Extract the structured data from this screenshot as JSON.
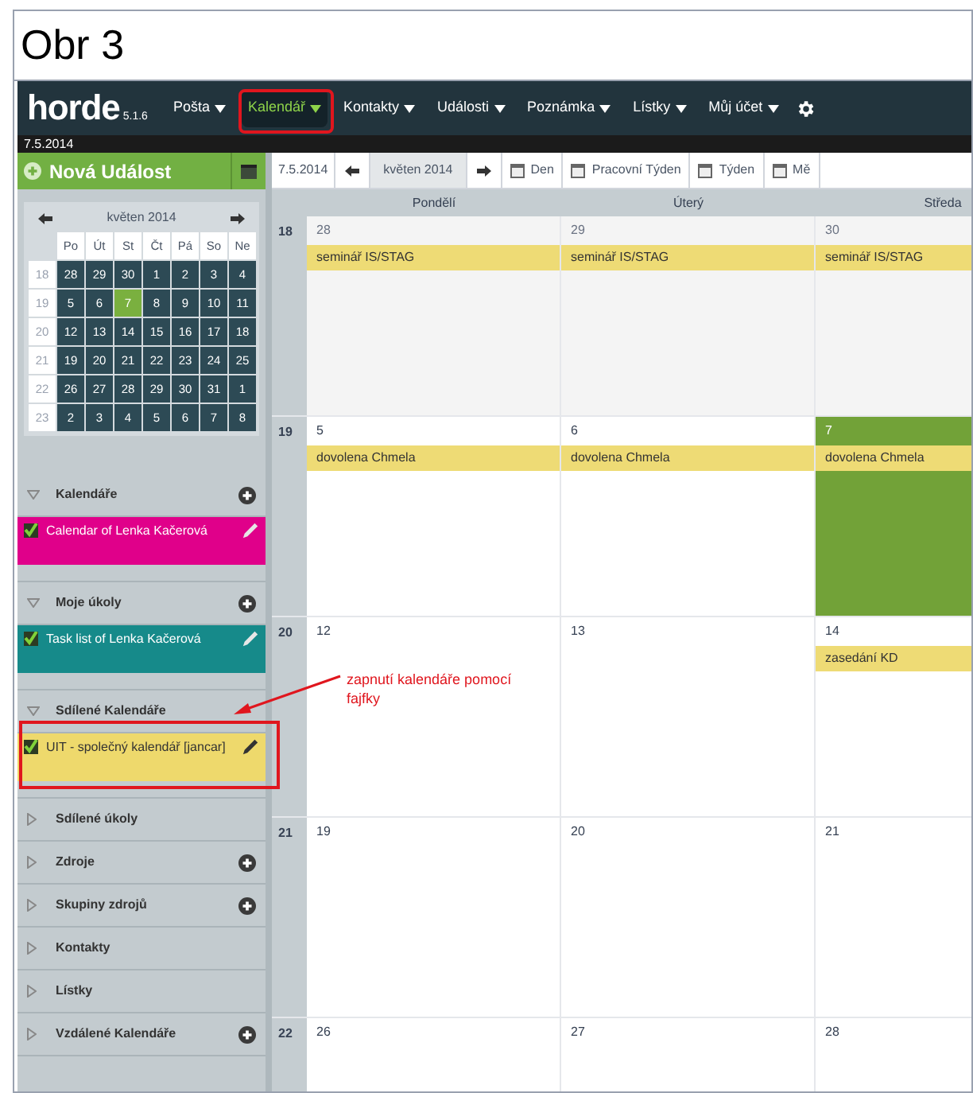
{
  "caption": "Obr 3",
  "app": {
    "logo": "horde",
    "version": "5.1.6",
    "menu": [
      {
        "label": "Pošta",
        "selected": false
      },
      {
        "label": "Kalendář",
        "selected": true
      },
      {
        "label": "Kontakty",
        "selected": false
      },
      {
        "label": "Události",
        "selected": false
      },
      {
        "label": "Poznámka",
        "selected": false
      },
      {
        "label": "Lístky",
        "selected": false
      },
      {
        "label": "Můj účet",
        "selected": false
      }
    ],
    "date": "7.5.2014"
  },
  "sidebar": {
    "new_event": "Nová Událost",
    "mini_calendar": {
      "title": "květen 2014",
      "weekdays": [
        "Po",
        "Út",
        "St",
        "Čt",
        "Pá",
        "So",
        "Ne"
      ],
      "weeks": [
        {
          "number": "18",
          "days": [
            {
              "label": "28",
              "selected": false
            },
            {
              "label": "29",
              "selected": false
            },
            {
              "label": "30",
              "selected": false
            },
            {
              "label": "1",
              "selected": false
            },
            {
              "label": "2",
              "selected": false
            },
            {
              "label": "3",
              "selected": false
            },
            {
              "label": "4",
              "selected": false
            }
          ]
        },
        {
          "number": "19",
          "days": [
            {
              "label": "5",
              "selected": false
            },
            {
              "label": "6",
              "selected": false
            },
            {
              "label": "7",
              "selected": true
            },
            {
              "label": "8",
              "selected": false
            },
            {
              "label": "9",
              "selected": false
            },
            {
              "label": "10",
              "selected": false
            },
            {
              "label": "11",
              "selected": false
            }
          ]
        },
        {
          "number": "20",
          "days": [
            {
              "label": "12",
              "selected": false
            },
            {
              "label": "13",
              "selected": false
            },
            {
              "label": "14",
              "selected": false
            },
            {
              "label": "15",
              "selected": false
            },
            {
              "label": "16",
              "selected": false
            },
            {
              "label": "17",
              "selected": false
            },
            {
              "label": "18",
              "selected": false
            }
          ]
        },
        {
          "number": "21",
          "days": [
            {
              "label": "19",
              "selected": false
            },
            {
              "label": "20",
              "selected": false
            },
            {
              "label": "21",
              "selected": false
            },
            {
              "label": "22",
              "selected": false
            },
            {
              "label": "23",
              "selected": false
            },
            {
              "label": "24",
              "selected": false
            },
            {
              "label": "25",
              "selected": false
            }
          ]
        },
        {
          "number": "22",
          "days": [
            {
              "label": "26",
              "selected": false
            },
            {
              "label": "27",
              "selected": false
            },
            {
              "label": "28",
              "selected": false
            },
            {
              "label": "29",
              "selected": false
            },
            {
              "label": "30",
              "selected": false
            },
            {
              "label": "31",
              "selected": false
            },
            {
              "label": "1",
              "selected": false
            }
          ]
        },
        {
          "number": "23",
          "days": [
            {
              "label": "2",
              "selected": false
            },
            {
              "label": "3",
              "selected": false
            },
            {
              "label": "4",
              "selected": false
            },
            {
              "label": "5",
              "selected": false
            },
            {
              "label": "6",
              "selected": false
            },
            {
              "label": "7",
              "selected": false
            },
            {
              "label": "8",
              "selected": false
            }
          ]
        }
      ]
    },
    "sections": [
      {
        "title": "Kalendáře",
        "expanded": true,
        "add": true,
        "items": [
          {
            "label": "Calendar of Lenka Kačerová",
            "color": "#e0008a",
            "checked": true
          }
        ]
      },
      {
        "title": "Moje úkoly",
        "expanded": true,
        "add": true,
        "items": [
          {
            "label": "Task list of Lenka Kačerová",
            "color": "#168a8a",
            "checked": true
          }
        ]
      },
      {
        "title": "Sdílené Kalendáře",
        "expanded": true,
        "add": false,
        "items": [
          {
            "label": "UIT - společný kalendář [jancar]",
            "color": "#eed96c",
            "checked": true
          }
        ]
      },
      {
        "title": "Sdílené úkoly",
        "expanded": false,
        "add": false
      },
      {
        "title": "Zdroje",
        "expanded": false,
        "add": true
      },
      {
        "title": "Skupiny zdrojů",
        "expanded": false,
        "add": true
      },
      {
        "title": "Kontakty",
        "expanded": false,
        "add": false
      },
      {
        "title": "Lístky",
        "expanded": false,
        "add": false
      },
      {
        "title": "Vzdálené Kalendáře",
        "expanded": false,
        "add": true
      }
    ]
  },
  "toolbar": {
    "today": "7.5.2014",
    "period": "květen 2014",
    "views": [
      "Den",
      "Pracovní Týden",
      "Týden",
      "Mě"
    ]
  },
  "calendar": {
    "columns": [
      "Pondělí",
      "Úterý",
      "Středa"
    ],
    "weeks": [
      {
        "number": "18",
        "days": [
          {
            "label": "28",
            "other_month": true,
            "today": false,
            "events": [
              "seminář IS/STAG"
            ]
          },
          {
            "label": "29",
            "other_month": true,
            "today": false,
            "events": [
              "seminář IS/STAG"
            ]
          },
          {
            "label": "30",
            "other_month": true,
            "today": false,
            "events": [
              "seminář IS/STAG"
            ]
          }
        ]
      },
      {
        "number": "19",
        "days": [
          {
            "label": "5",
            "other_month": false,
            "today": false,
            "events": [
              "dovolena Chmela"
            ]
          },
          {
            "label": "6",
            "other_month": false,
            "today": false,
            "events": [
              "dovolena Chmela"
            ]
          },
          {
            "label": "7",
            "other_month": false,
            "today": true,
            "events": [
              "dovolena Chmela"
            ]
          }
        ]
      },
      {
        "number": "20",
        "days": [
          {
            "label": "12",
            "other_month": false,
            "today": false
          },
          {
            "label": "13",
            "other_month": false,
            "today": false
          },
          {
            "label": "14",
            "other_month": false,
            "today": false,
            "events": [
              "zasedání KD"
            ]
          }
        ]
      },
      {
        "number": "21",
        "days": [
          {
            "label": "19",
            "other_month": false,
            "today": false
          },
          {
            "label": "20",
            "other_month": false,
            "today": false
          },
          {
            "label": "21",
            "other_month": false,
            "today": false
          }
        ]
      },
      {
        "number": "22",
        "days": [
          {
            "label": "26",
            "other_month": false,
            "today": false
          },
          {
            "label": "27",
            "other_month": false,
            "today": false
          },
          {
            "label": "28",
            "other_month": false,
            "today": false
          }
        ]
      }
    ]
  },
  "annotation": {
    "note": "zapnutí kalendáře pomocí fajfky"
  }
}
